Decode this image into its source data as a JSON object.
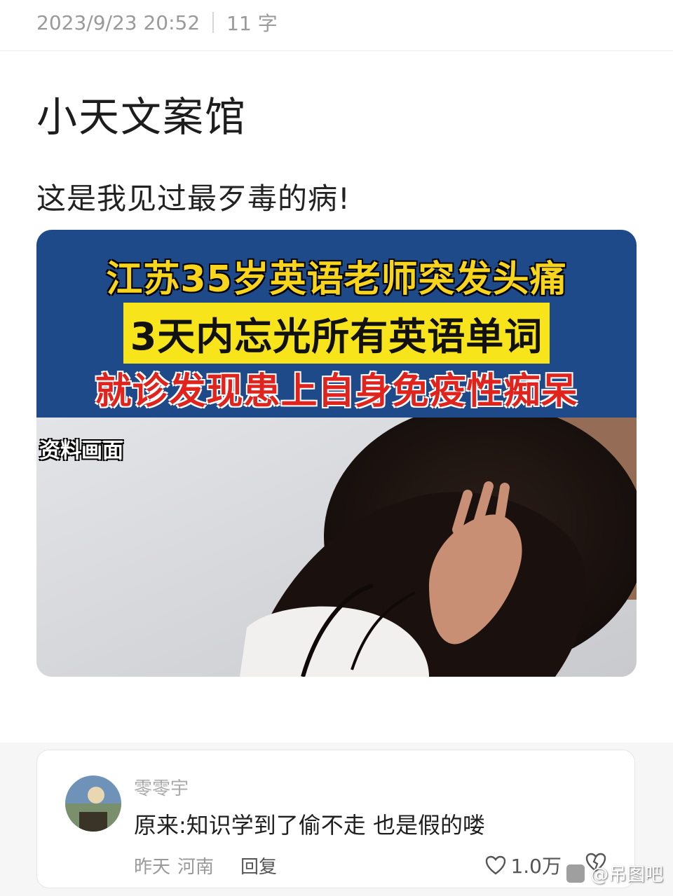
{
  "meta": {
    "timestamp": "2023/9/23 20:52",
    "word_count": "11 字"
  },
  "post": {
    "title": "小天文案馆",
    "body": "这是我见过最歹毒的病!"
  },
  "news_image": {
    "headline_1": "江苏35岁英语老师突发头痛",
    "headline_2": "3天内忘光所有英语单词",
    "headline_3": "就诊发现患上自身免疫性痴呆",
    "label": "资料画面",
    "colors": {
      "band": "#1e4a8a",
      "yellow": "#f7d51d",
      "red": "#e0231c"
    }
  },
  "comment": {
    "username": "零零宇",
    "text": "原来:知识学到了偷不走 也是假的喽",
    "time": "昨天",
    "location": "河南",
    "reply_label": "回复",
    "like_count": "1.0万"
  },
  "watermark": {
    "text": "@吊图吧"
  }
}
